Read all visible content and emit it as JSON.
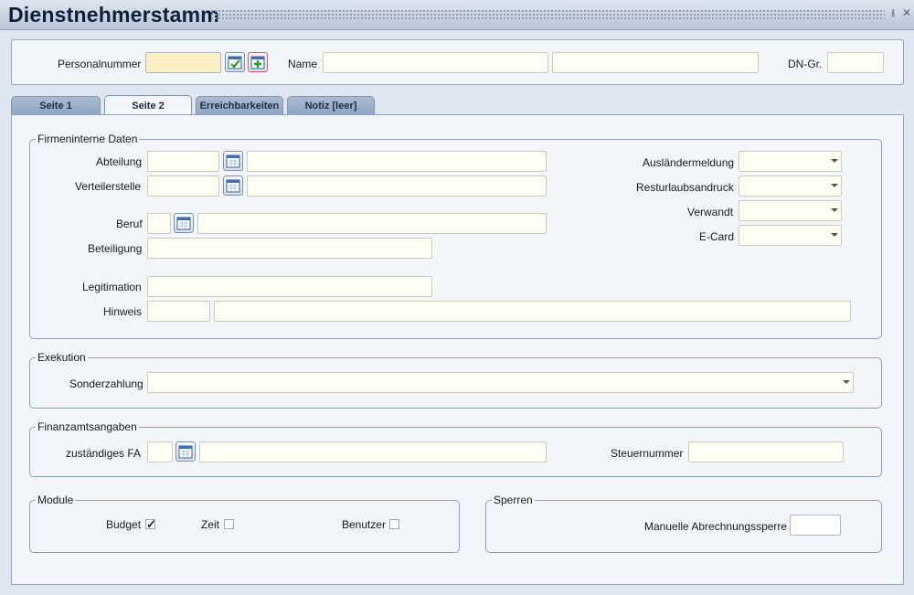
{
  "window": {
    "title": "Dienstnehmerstamm"
  },
  "header": {
    "personalnummer_label": "Personalnummer",
    "personalnummer_value": "",
    "name_label": "Name",
    "name_first_value": "",
    "name_second_value": "",
    "dn_gr_label": "DN-Gr.",
    "dn_gr_value": ""
  },
  "tabs": [
    {
      "label": "Seite 1",
      "active": false
    },
    {
      "label": "Seite 2",
      "active": true
    },
    {
      "label": "Erreichbarkeiten",
      "active": false
    },
    {
      "label": "Notiz [leer]",
      "active": false
    }
  ],
  "firmeninterne": {
    "legend": "Firmeninterne Daten",
    "abteilung_label": "Abteilung",
    "verteilerstelle_label": "Verteilerstelle",
    "beruf_label": "Beruf",
    "beteiligung_label": "Beteiligung",
    "legitimation_label": "Legitimation",
    "hinweis_label": "Hinweis",
    "auslaendermeldung_label": "Ausländermeldung",
    "resturlaubsandruck_label": "Resturlaubsandruck",
    "verwandt_label": "Verwandt",
    "ecard_label": "E-Card"
  },
  "exekution": {
    "legend": "Exekution",
    "sonderzahlung_label": "Sonderzahlung",
    "sonderzahlung_value": ""
  },
  "finanzamt": {
    "legend": "Finanzamtsangaben",
    "fa_label": "zuständiges FA",
    "steuernummer_label": "Steuernummer"
  },
  "module": {
    "legend": "Module",
    "budget_label": "Budget",
    "budget_checked": true,
    "zeit_label": "Zeit",
    "zeit_checked": false,
    "benutzer_label": "Benutzer",
    "benutzer_checked": false
  },
  "sperren": {
    "legend": "Sperren",
    "abrechnungssperre_label": "Manuelle Abrechnungssperre",
    "abrechnungssperre_value": ""
  },
  "icons": {
    "lookup": "calendar-lookup-icon",
    "confirm": "check-icon",
    "add": "plus-icon",
    "dropdown": "chevron-down-icon"
  },
  "colors": {
    "highlight_field": "#fdf0c6",
    "panel_bg": "#f2f5f9",
    "tab_inactive": "#8fa6c3",
    "title_text": "#0d1f3c"
  }
}
